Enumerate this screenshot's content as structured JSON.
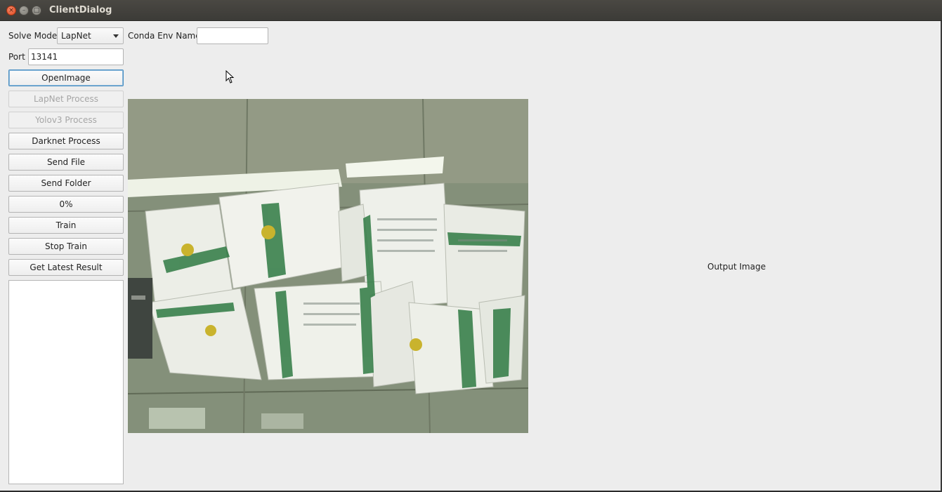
{
  "window": {
    "title": "ClientDialog",
    "buttons": {
      "close": "×",
      "minimize": "–",
      "maximize": "□"
    }
  },
  "controls": {
    "solve_mode_label": "Solve Mode:",
    "solve_mode_value": "LapNet",
    "conda_env_label": "Conda Env Name:",
    "conda_env_value": "",
    "port_label": "Port",
    "port_value": "13141"
  },
  "buttons": {
    "open_image": "OpenImage",
    "lapnet_process": "LapNet Process",
    "yolov3_process": "Yolov3 Process",
    "darknet_process": "Darknet Process",
    "send_file": "Send File",
    "send_folder": "Send Folder",
    "progress": "0%",
    "train": "Train",
    "stop_train": "Stop Train",
    "get_latest_result": "Get Latest Result"
  },
  "progress_value": 0,
  "output": {
    "placeholder": "Output Image"
  },
  "colors": {
    "titlebar": "#3c3b37",
    "surface": "#ededed",
    "close": "#e0481f",
    "focus": "#4a8fc2"
  }
}
